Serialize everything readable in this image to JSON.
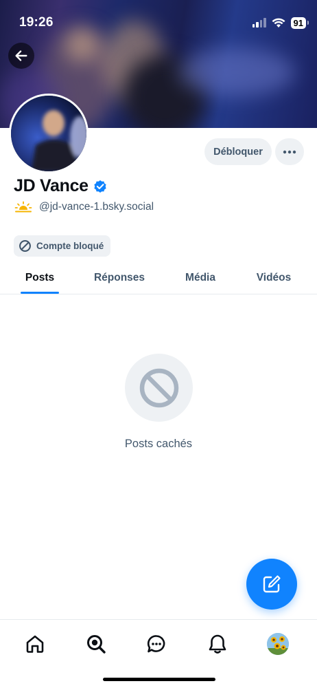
{
  "status_bar": {
    "time": "19:26",
    "battery": "91"
  },
  "profile": {
    "display_name": "JD Vance",
    "handle": "@jd-vance-1.bsky.social",
    "unblock_label": "Débloquer",
    "blocked_badge": "Compte bloqué"
  },
  "tabs": [
    {
      "label": "Posts",
      "active": true
    },
    {
      "label": "Réponses",
      "active": false
    },
    {
      "label": "Média",
      "active": false
    },
    {
      "label": "Vidéos",
      "active": false
    }
  ],
  "empty_state": {
    "text": "Posts cachés"
  },
  "colors": {
    "accent": "#1083fe",
    "muted_text": "#42576c",
    "chip_bg": "#eef1f4"
  },
  "icons": {
    "back": "arrow-left-icon",
    "more": "ellipsis-icon",
    "verified": "verified-check-icon",
    "blocked": "block-icon",
    "compose": "compose-icon",
    "nav": [
      "home-icon",
      "search-icon",
      "chat-icon",
      "bell-icon",
      "profile-avatar"
    ]
  }
}
